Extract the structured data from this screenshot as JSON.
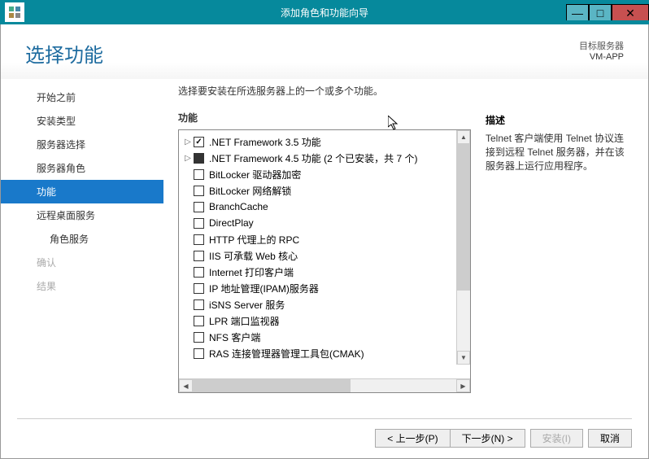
{
  "window": {
    "title": "添加角色和功能向导"
  },
  "header": {
    "title": "选择功能",
    "server_label": "目标服务器",
    "server_name": "VM-APP"
  },
  "sidebar": {
    "items": [
      {
        "label": "开始之前",
        "state": "normal"
      },
      {
        "label": "安装类型",
        "state": "normal"
      },
      {
        "label": "服务器选择",
        "state": "normal"
      },
      {
        "label": "服务器角色",
        "state": "normal"
      },
      {
        "label": "功能",
        "state": "active"
      },
      {
        "label": "远程桌面服务",
        "state": "normal"
      },
      {
        "label": "角色服务",
        "state": "sub"
      },
      {
        "label": "确认",
        "state": "disabled"
      },
      {
        "label": "结果",
        "state": "disabled"
      }
    ]
  },
  "center": {
    "instruction": "选择要安装在所选服务器上的一个或多个功能。",
    "section_label": "功能",
    "items": [
      {
        "expand": true,
        "check": "checked",
        "label": ".NET Framework 3.5 功能"
      },
      {
        "expand": true,
        "check": "filled",
        "label": ".NET Framework 4.5 功能 (2 个已安装，共 7 个)"
      },
      {
        "expand": false,
        "check": "empty",
        "label": "BitLocker 驱动器加密"
      },
      {
        "expand": false,
        "check": "empty",
        "label": "BitLocker 网络解锁"
      },
      {
        "expand": false,
        "check": "empty",
        "label": "BranchCache"
      },
      {
        "expand": false,
        "check": "empty",
        "label": "DirectPlay"
      },
      {
        "expand": false,
        "check": "empty",
        "label": "HTTP 代理上的 RPC"
      },
      {
        "expand": false,
        "check": "empty",
        "label": "IIS 可承载 Web 核心"
      },
      {
        "expand": false,
        "check": "empty",
        "label": "Internet 打印客户端"
      },
      {
        "expand": false,
        "check": "empty",
        "label": "IP 地址管理(IPAM)服务器"
      },
      {
        "expand": false,
        "check": "empty",
        "label": "iSNS Server 服务"
      },
      {
        "expand": false,
        "check": "empty",
        "label": "LPR 端口监视器"
      },
      {
        "expand": false,
        "check": "empty",
        "label": "NFS 客户端"
      },
      {
        "expand": false,
        "check": "empty",
        "label": "RAS 连接管理器管理工具包(CMAK)"
      }
    ]
  },
  "right": {
    "label": "描述",
    "text": "Telnet 客户端使用 Telnet 协议连接到远程 Telnet 服务器，并在该服务器上运行应用程序。"
  },
  "footer": {
    "prev": "< 上一步(P)",
    "next": "下一步(N) >",
    "install": "安装(I)",
    "cancel": "取消"
  }
}
